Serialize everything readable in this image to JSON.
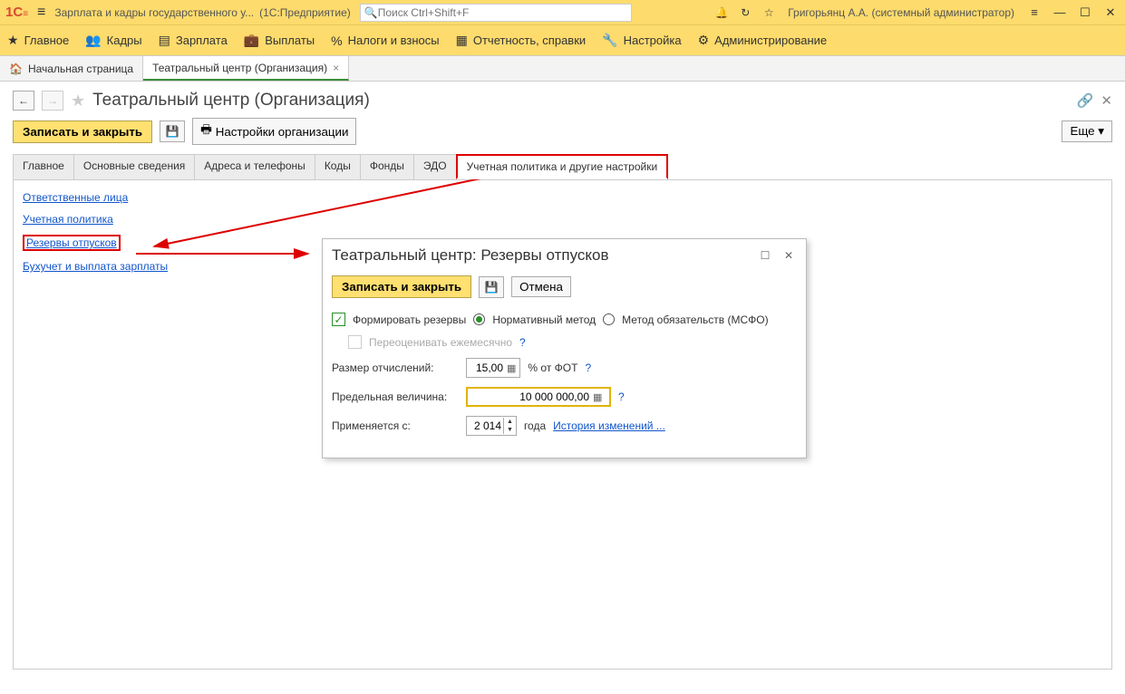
{
  "titlebar": {
    "app_title": "Зарплата и кадры государственного у...",
    "platform": "(1С:Предприятие)",
    "search_placeholder": "Поиск Ctrl+Shift+F",
    "user": "Григорьянц А.А. (системный администратор)"
  },
  "toolbar": {
    "items": [
      {
        "icon": "★",
        "label": "Главное"
      },
      {
        "icon": "👥",
        "label": "Кадры"
      },
      {
        "icon": "▤",
        "label": "Зарплата"
      },
      {
        "icon": "💼",
        "label": "Выплаты"
      },
      {
        "icon": "%",
        "label": "Налоги и взносы"
      },
      {
        "icon": "▦",
        "label": "Отчетность, справки"
      },
      {
        "icon": "🔧",
        "label": "Настройка"
      },
      {
        "icon": "⚙",
        "label": "Администрирование"
      }
    ]
  },
  "tabs": {
    "home": "Начальная страница",
    "open": "Театральный центр (Организация)"
  },
  "page": {
    "title": "Театральный центр (Организация)",
    "save_close": "Записать и закрыть",
    "settings_btn": "Настройки организации",
    "more_btn": "Еще"
  },
  "inner_tabs": [
    "Главное",
    "Основные сведения",
    "Адреса и телефоны",
    "Коды",
    "Фонды",
    "ЭДО",
    "Учетная политика и другие настройки"
  ],
  "links": [
    "Ответственные лица",
    "Учетная политика",
    "Резервы отпусков",
    "Бухучет и выплата зарплаты"
  ],
  "dialog": {
    "title": "Театральный центр: Резервы отпусков",
    "save_close": "Записать и закрыть",
    "cancel": "Отмена",
    "form_reserves": "Формировать резервы",
    "method_norm": "Нормативный метод",
    "method_msfo": "Метод обязательств (МСФО)",
    "reeval": "Переоценивать ежемесячно",
    "deduct_label": "Размер отчислений:",
    "deduct_value": "15,00",
    "deduct_suffix": "% от ФОТ",
    "limit_label": "Предельная величина:",
    "limit_value": "10 000 000,00",
    "applies_label": "Применяется с:",
    "applies_year": "2 014",
    "year_word": "года",
    "history_link": "История изменений ..."
  }
}
